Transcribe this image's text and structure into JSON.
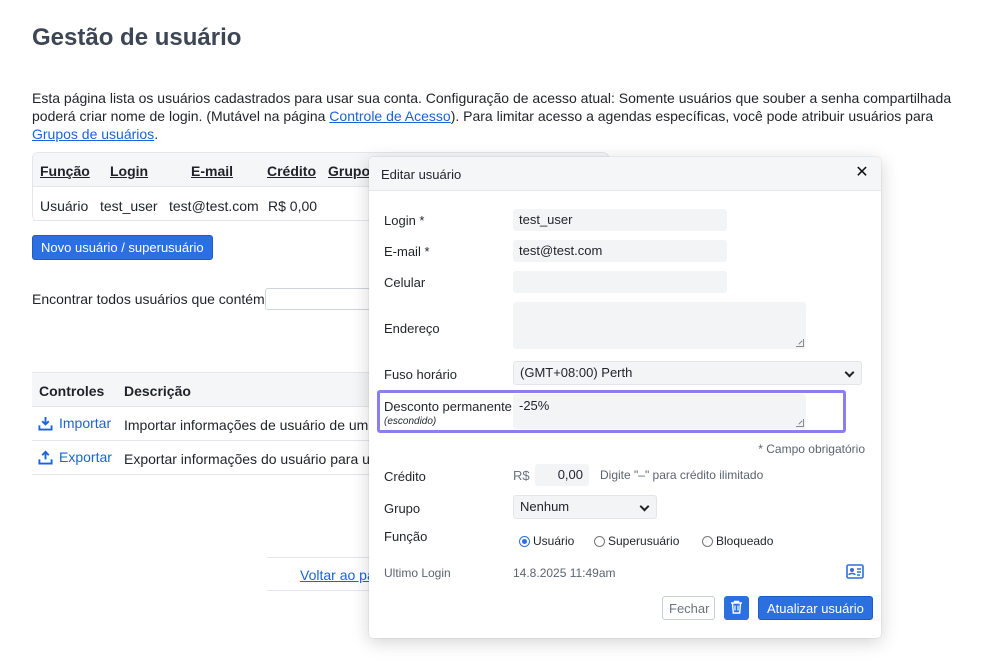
{
  "page": {
    "title": "Gestão de usuário",
    "intro_part1": "Esta página lista os usuários cadastrados para usar sua conta. Configuração de acesso atual: Somente usuários que souber a senha compartilhada poderá criar nome de login. (Mutável na página ",
    "intro_link1": "Controle de Acesso",
    "intro_part2": "). Para limitar acesso a agendas específicas, você pode atribuir usuários para ",
    "intro_link2": "Grupos de usuários",
    "intro_part3": "."
  },
  "users_table": {
    "headers": [
      "Função",
      "Login",
      "E-mail",
      "Crédito",
      "Grupo"
    ],
    "rows": [
      {
        "role": "Usuário",
        "login": "test_user",
        "email": "test@test.com",
        "credit": "R$ 0,00"
      }
    ]
  },
  "new_user_button": "Novo usuário / superusuário",
  "find_label": "Encontrar todos usuários que contém",
  "controls_table": {
    "headers": [
      "Controles",
      "Descrição"
    ],
    "rows": [
      {
        "control": "Importar",
        "description": "Importar informações de usuário de um ar"
      },
      {
        "control": "Exportar",
        "description": "Exportar informações do usuário para um"
      }
    ]
  },
  "back_link": "Voltar ao pa",
  "modal": {
    "title": "Editar usuário",
    "fields": {
      "login_label": "Login *",
      "login_value": "test_user",
      "email_label": "E-mail *",
      "email_value": "test@test.com",
      "cell_label": "Celular",
      "cell_value": "",
      "address_label": "Endereço",
      "address_value": "",
      "timezone_label": "Fuso horário",
      "timezone_value": "(GMT+08:00) Perth",
      "discount_label": "Desconto permanente",
      "discount_sublabel": "(escondido)",
      "discount_value": "-25%",
      "required_note": "* Campo obrigatório",
      "credit_label": "Crédito",
      "credit_currency": "R$",
      "credit_value": "0,00",
      "credit_hint": "Digite \"–\" para crédito ilimitado",
      "group_label": "Grupo",
      "group_value": "Nenhum",
      "role_label": "Função",
      "role_options": [
        "Usuário",
        "Superusuário",
        "Bloqueado"
      ],
      "role_selected": "Usuário",
      "last_login_label": "Ultimo Login",
      "last_login_value": "14.8.2025 11:49am"
    },
    "buttons": {
      "close": "Fechar",
      "update": "Atualizar usuário"
    }
  },
  "colors": {
    "primary": "#2b6fe0",
    "link": "#1a63d8",
    "highlight": "#8b7ff0"
  }
}
